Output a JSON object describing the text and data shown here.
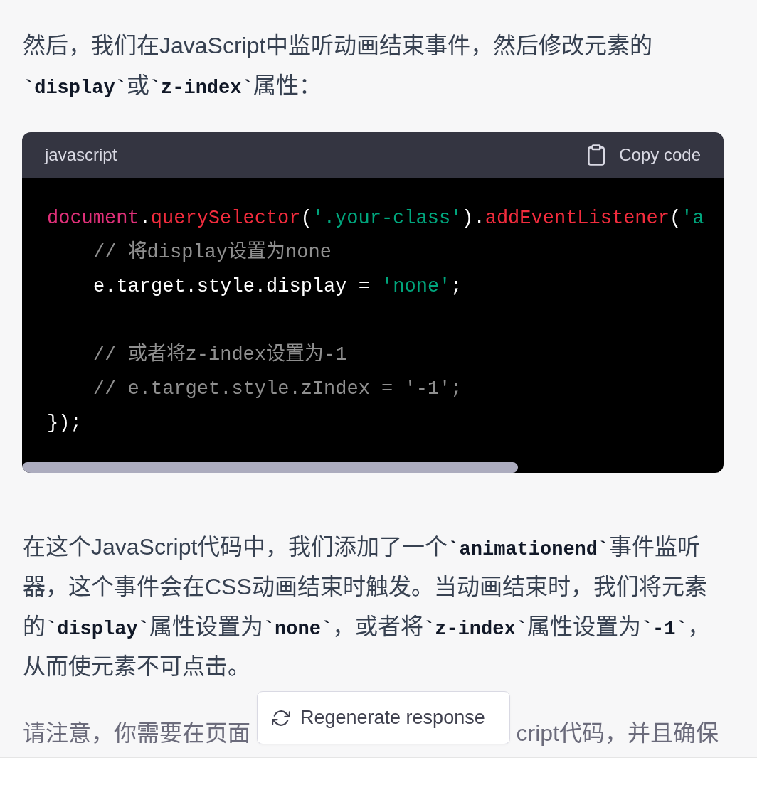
{
  "message": {
    "blocks": [
      {
        "kind": "paragraph",
        "text": "然后，我们在JavaScript中监听动画结束事件，然后修改元素的**`display`**或**`z-index`**属性："
      },
      {
        "kind": "code",
        "language": "javascript",
        "copy_button": "Copy code",
        "lines": [
          {
            "kind": "code",
            "tokens": [
              {
                "kind": "variable",
                "text": "document"
              },
              {
                "kind": "plain",
                "text": "."
              },
              {
                "kind": "function",
                "text": "querySelector"
              },
              {
                "kind": "plain",
                "text": "("
              },
              {
                "kind": "string",
                "text": "'.your-class'"
              },
              {
                "kind": "plain",
                "text": ")."
              },
              {
                "kind": "function",
                "text": "addEventListener"
              },
              {
                "kind": "plain",
                "text": "("
              },
              {
                "kind": "string",
                "text": "'a"
              }
            ],
            "children": [
              {
                "kind": "code",
                "tokens": [
                  {
                    "kind": "comment",
                    "text": "// 将display设置为none"
                  }
                ]
              },
              {
                "kind": "code",
                "tokens": [
                  {
                    "kind": "plain",
                    "text": "e.target.style.display = "
                  },
                  {
                    "kind": "string",
                    "text": "'none'"
                  },
                  {
                    "kind": "plain",
                    "text": ";"
                  }
                ]
              },
              {
                "kind": "blank"
              },
              {
                "kind": "code",
                "tokens": [
                  {
                    "kind": "comment",
                    "text": "// 或者将z-index设置为-1"
                  }
                ]
              },
              {
                "kind": "code",
                "tokens": [
                  {
                    "kind": "comment",
                    "text": "// e.target.style.zIndex = '-1';"
                  }
                ]
              }
            ]
          },
          {
            "kind": "code",
            "tokens": [
              {
                "kind": "plain",
                "text": "});"
              }
            ]
          }
        ]
      },
      {
        "kind": "paragraph",
        "text": "在这个JavaScript代码中，我们添加了一个**`animationend`**事件监听器，这个事件会在CSS动画结束时触发。当动画结束时，我们将元素的**`display`**属性设置为**`none`**，或者将**`z-index`**属性设置为**`-1`**，从而使元素不可点击。"
      },
      {
        "kind": "partial_paragraph",
        "parts": [
          "请注意，你需要在页面",
          "cript代码，并且确保"
        ]
      }
    ]
  },
  "regenerate_button": {
    "label": "Regenerate response"
  }
}
